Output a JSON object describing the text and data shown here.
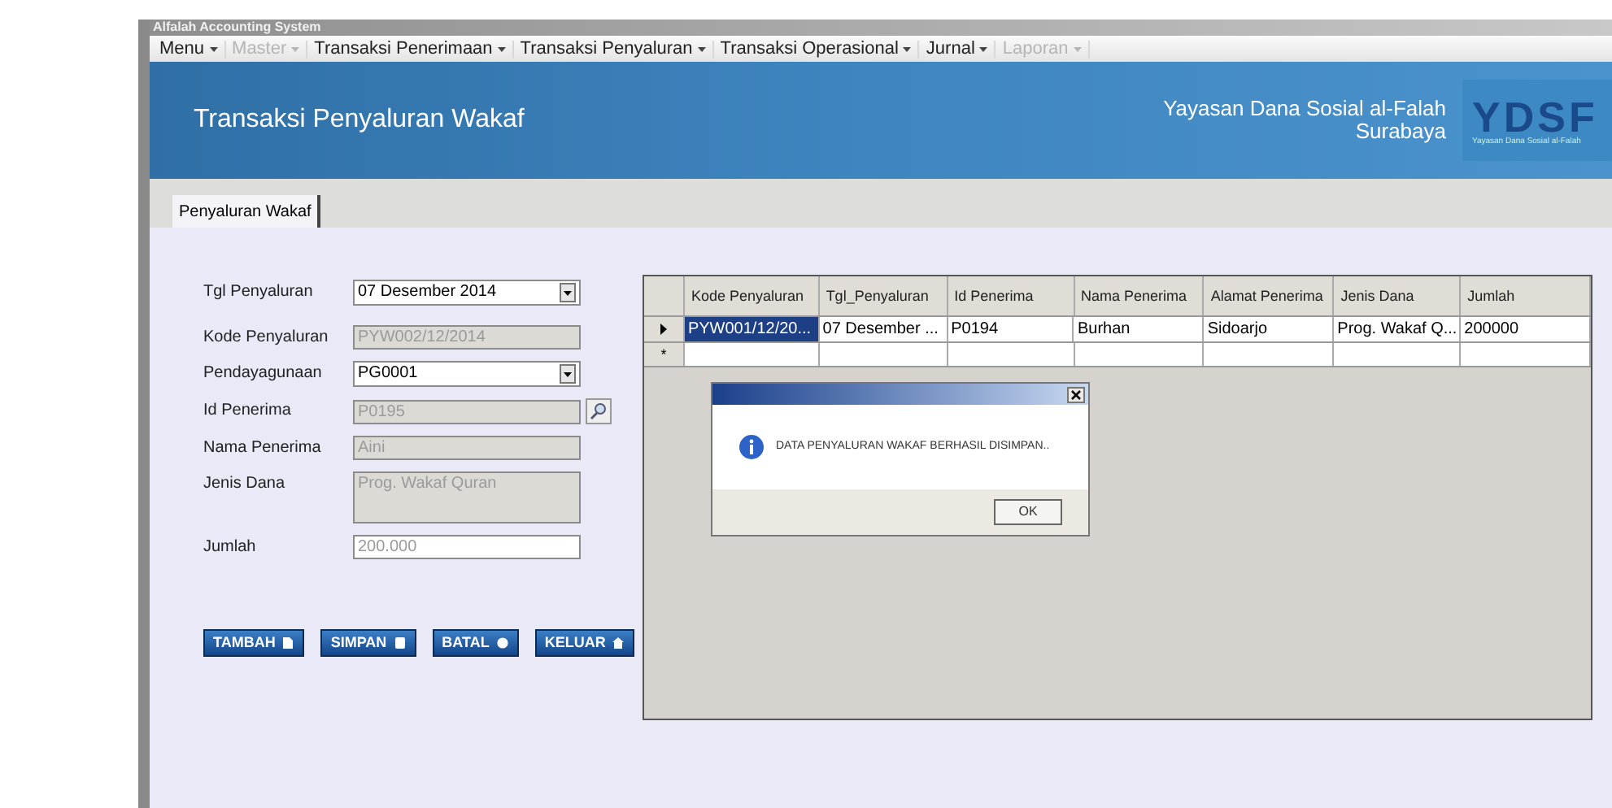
{
  "window": {
    "title": "Alfalah Accounting System"
  },
  "menu": [
    {
      "label": "Menu",
      "disabled": false
    },
    {
      "label": "Master",
      "disabled": true
    },
    {
      "label": "Transaksi Penerimaan",
      "disabled": false
    },
    {
      "label": "Transaksi Penyaluran",
      "disabled": false
    },
    {
      "label": "Transaksi Operasional",
      "disabled": false
    },
    {
      "label": "Jurnal",
      "disabled": false
    },
    {
      "label": "Laporan",
      "disabled": true
    }
  ],
  "banner": {
    "title": "Transaksi Penyaluran Wakaf",
    "org_line_1": "Yayasan Dana Sosial al-Falah",
    "org_line_2": "Surabaya",
    "logo_text": "YDSF",
    "logo_caption": "Yayasan Dana Sosial al-Falah"
  },
  "tabs": [
    {
      "label": "Penyaluran Wakaf",
      "selected": true
    }
  ],
  "form": [
    {
      "label": "Tgl Penyaluran",
      "kind": "dropdown",
      "value": "07 Desember 2014",
      "readonly": false
    },
    {
      "label": "Kode Penyaluran",
      "kind": "text",
      "value": "PYW002/12/2014",
      "readonly": true
    },
    {
      "label": "Pendayagunaan",
      "kind": "dropdown",
      "value": "PG0001",
      "readonly": false
    },
    {
      "label": "Id Penerima",
      "kind": "lookup",
      "value": "P0195",
      "readonly": true
    },
    {
      "label": "Nama Penerima",
      "kind": "text",
      "value": "Aini",
      "readonly": true
    },
    {
      "label": "Jenis Dana",
      "kind": "textarea",
      "value": "Prog. Wakaf Quran",
      "readonly": true
    },
    {
      "label": "Jumlah",
      "kind": "text",
      "value": "200.000",
      "readonly": false
    }
  ],
  "buttons": [
    "TAMBAH",
    "SIMPAN",
    "BATAL",
    "KELUAR"
  ],
  "table": {
    "columns": [
      "Kode Penyaluran",
      "Tgl_Penyaluran",
      "Id Penerima",
      "Nama Penerima",
      "Alamat Penerima",
      "Jenis Dana",
      "Jumlah"
    ],
    "rows": [
      {
        "selected": true,
        "cells": [
          "PYW001/12/20...",
          "07 Desember ...",
          "P0194",
          "Burhan",
          "Sidoarjo",
          "Prog. Wakaf Q...",
          "200000"
        ]
      }
    ],
    "new_row_marker": "*"
  },
  "dialog": {
    "message": "DATA PENYALURAN WAKAF BERHASIL DISIMPAN..",
    "ok": "OK"
  }
}
